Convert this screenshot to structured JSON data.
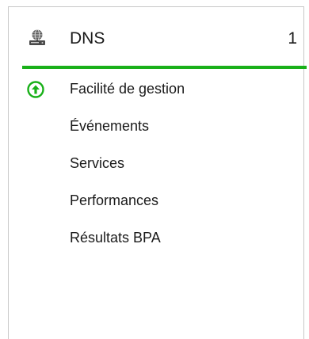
{
  "tile": {
    "title": "DNS",
    "count": "1",
    "status_color": "#19b019",
    "header_icon": "server-globe-icon"
  },
  "items": [
    {
      "label": "Facilité de gestion",
      "icon": "green-up-arrow-icon"
    },
    {
      "label": "Événements"
    },
    {
      "label": "Services"
    },
    {
      "label": "Performances"
    },
    {
      "label": "Résultats BPA"
    }
  ]
}
